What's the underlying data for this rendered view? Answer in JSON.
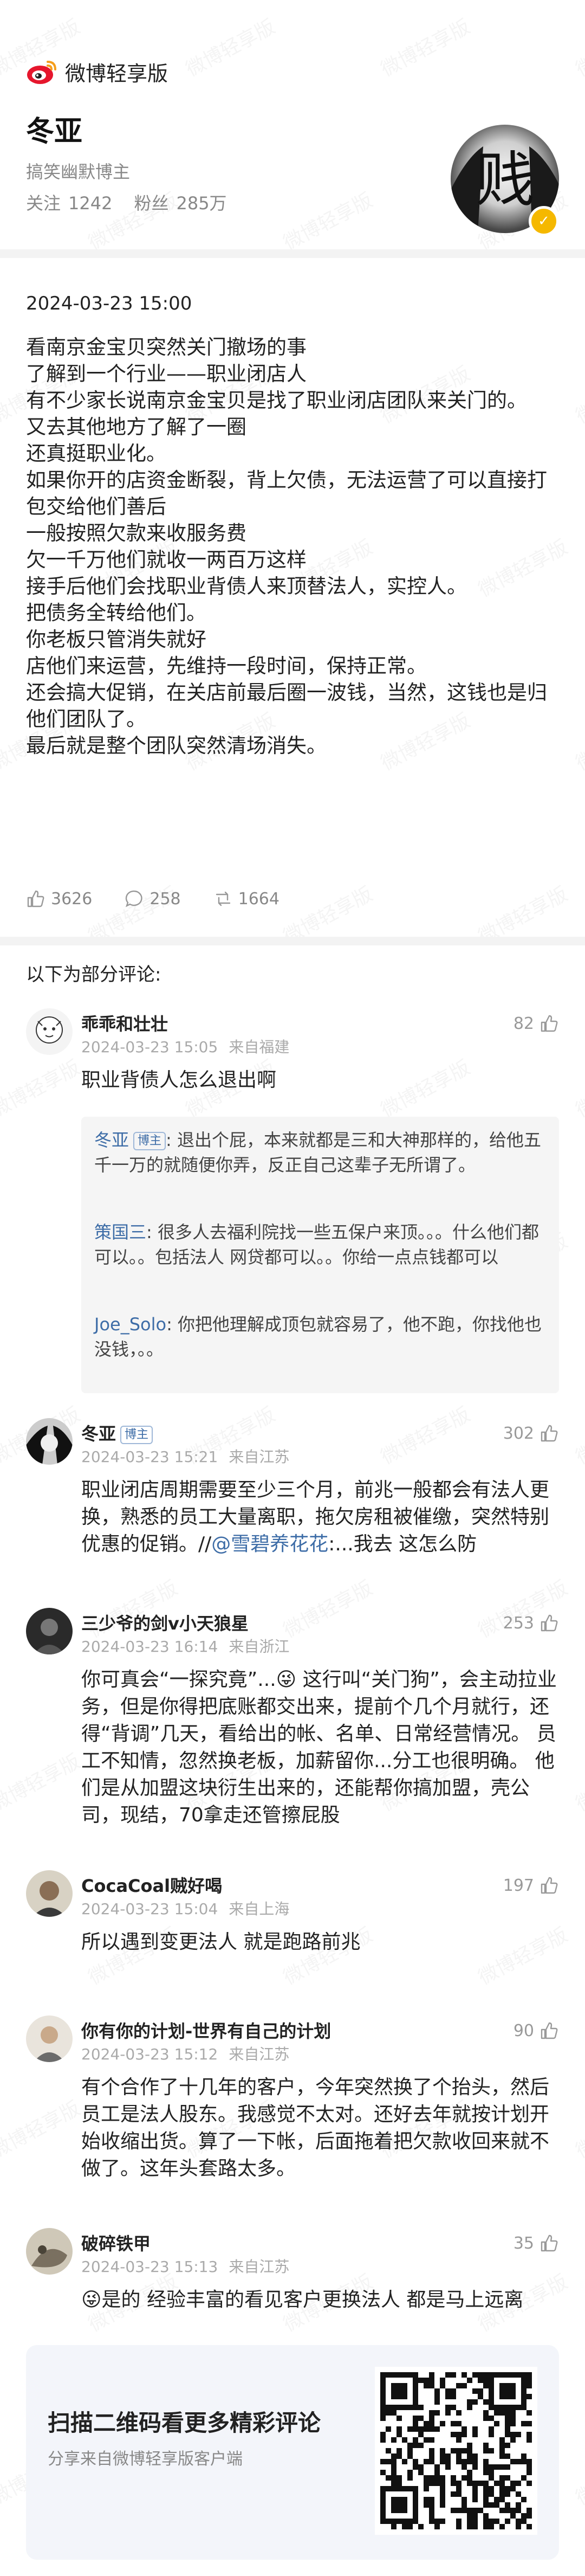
{
  "app": {
    "title": "微博轻享版"
  },
  "profile": {
    "name": "冬亚",
    "desc": "搞笑幽默博主",
    "follow_label": "关注",
    "follow_count": "1242",
    "fans_label": "粉丝",
    "fans_count": "285万",
    "avatar_char": "贱"
  },
  "post": {
    "time": "2024-03-23 15:00",
    "lines": [
      "看南京金宝贝突然关门撤场的事",
      "了解到一个行业——职业闭店人",
      "有不少家长说南京金宝贝是找了职业闭店团队来关门的。",
      "又去其他地方了解了一圈",
      "还真挺职业化。",
      "如果你开的店资金断裂，背上欠债，无法运营了可以直接打包交给他们善后",
      "一般按照欠款来收服务费",
      "欠一千万他们就收一两百万这样",
      "接手后他们会找职业背债人来顶替法人，实控人。",
      "把债务全转给他们。",
      "你老板只管消失就好",
      "店他们来运营，先维持一段时间，保持正常。",
      "还会搞大促销，在关店前最后圈一波钱，当然，这钱也是归他们团队了。",
      "最后就是整个团队突然清场消失。"
    ],
    "likes": "3626",
    "comments": "258",
    "reposts": "1664"
  },
  "comments_title": "以下为部分评论:",
  "comments": [
    {
      "name": "乖乖和壮壮",
      "time": "2024-03-23 15:05",
      "loc": "来自福建",
      "likes": "82",
      "text": "职业背债人怎么退出啊",
      "replies": [
        {
          "who": "冬亚",
          "badge": "博主",
          "text": ": 退出个屁，本来就都是三和大神那样的，给他五千一万的就随便你弄，反正自己这辈子无所谓了。"
        },
        {
          "who": "策国三",
          "text": ": 很多人去福利院找一些五保户来顶。。。什么他们都可以。。包括法人 网贷都可以。。你给一点点钱都可以"
        },
        {
          "who": "Joe_Solo",
          "text": ": 你把他理解成顶包就容易了，他不跑，你找他也没钱，。。"
        }
      ]
    },
    {
      "name": "冬亚",
      "badge": "博主",
      "time": "2024-03-23 15:21",
      "loc": "来自江苏",
      "likes": "302",
      "text_pre": "职业闭店周期需要至少三个月，前兆一般都会有法人更换，熟悉的员工大量离职，拖欠房租被催缴，突然特别优惠的促销。//",
      "mention": "@雪碧养花花",
      "text_post": ":...我去 这怎么防"
    },
    {
      "name": "三少爷的剑v小天狼星",
      "time": "2024-03-23 16:14",
      "loc": "来自浙江",
      "likes": "253",
      "text": "你可真会“一探究竟”...😜 这行叫“关门狗”，会主动拉业务，但是你得把底账都交出来，提前个几个月就行，还得“背调”几天，看给出的帐、名单、日常经营情况。 员工不知情，忽然换老板，加薪留你...分工也很明确。 他们是从加盟这块衍生出来的，还能帮你搞加盟，壳公司，现结，70拿走还管擦屁股"
    },
    {
      "name": "CocaCoal贼好喝",
      "time": "2024-03-23 15:04",
      "loc": "来自上海",
      "likes": "197",
      "text": "所以遇到变更法人 就是跑路前兆"
    },
    {
      "name": "你有你的计划-世界有自己的计划",
      "time": "2024-03-23 15:12",
      "loc": "来自江苏",
      "likes": "90",
      "text": "有个合作了十几年的客户，今年突然换了个抬头，然后员工是法人股东。我感觉不太对。还好去年就按计划开始收缩出货。算了一下帐，后面拖着把欠款收回来就不做了。这年头套路太多。"
    },
    {
      "name": "破碎铁甲",
      "time": "2024-03-23 15:13",
      "loc": "来自江苏",
      "likes": "35",
      "text": "😜是的 经验丰富的看见客户更换法人 都是马上远离"
    }
  ],
  "bottom_card": {
    "title": "扫描二维码看更多精彩评论",
    "subtitle": "分享来自微博轻享版客户端"
  },
  "watermark": "微博轻享版",
  "colors": {
    "brand": "#e6162d",
    "mention": "#e6732c",
    "link": "#3e6da7",
    "badge_gold": "#f5b800"
  }
}
